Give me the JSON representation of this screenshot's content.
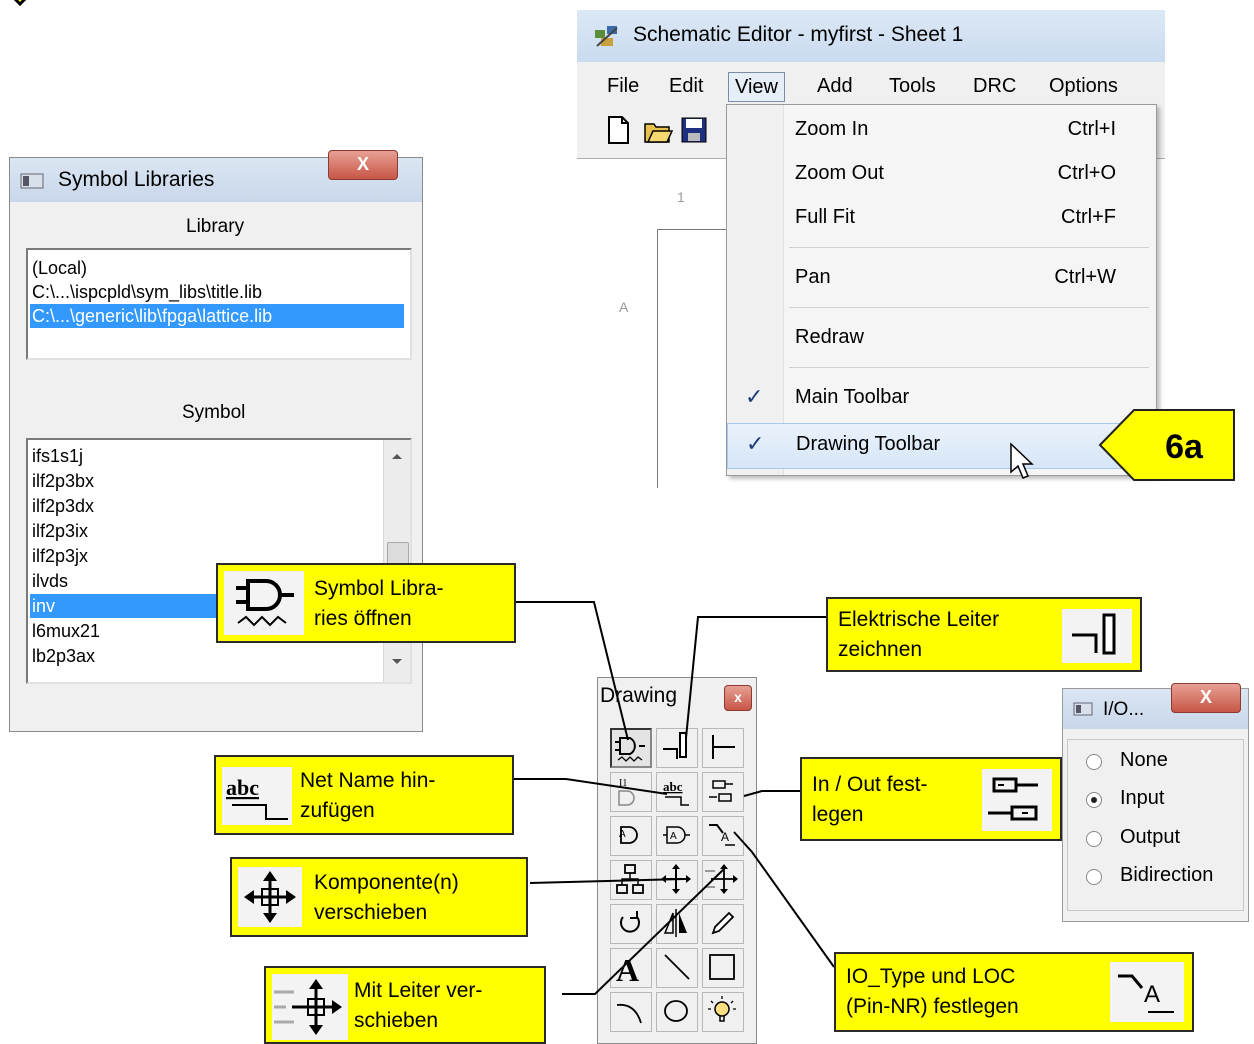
{
  "schematic_editor": {
    "title": "Schematic Editor - myfirst - Sheet 1",
    "menu": [
      "File",
      "Edit",
      "View",
      "Add",
      "Tools",
      "DRC",
      "Options"
    ],
    "active_menu": "View",
    "canvas_labels": {
      "column": "1",
      "row": "A"
    },
    "view_menu": {
      "items": [
        {
          "label": "Zoom In",
          "shortcut": "Ctrl+I",
          "checked": false
        },
        {
          "label": "Zoom Out",
          "shortcut": "Ctrl+O",
          "checked": false
        },
        {
          "label": "Full Fit",
          "shortcut": "Ctrl+F",
          "checked": false
        },
        {
          "label": "Pan",
          "shortcut": "Ctrl+W",
          "checked": false
        },
        {
          "label": "Redraw",
          "shortcut": "",
          "checked": false
        },
        {
          "label": "Main Toolbar",
          "shortcut": "",
          "checked": true
        },
        {
          "label": "Drawing Toolbar",
          "shortcut": "",
          "checked": true
        }
      ],
      "check_glyph": "✓",
      "highlighted": "Drawing Toolbar"
    }
  },
  "step_badge": "6a",
  "symbol_libraries": {
    "title": "Symbol Libraries",
    "close_label": "X",
    "library_header": "Library",
    "libraries": [
      "(Local)",
      "C:\\...\\ispcpld\\sym_libs\\title.lib",
      "C:\\...\\generic\\lib\\fpga\\lattice.lib"
    ],
    "selected_library": "C:\\...\\generic\\lib\\fpga\\lattice.lib",
    "symbol_header": "Symbol",
    "symbols": [
      "ifs1s1j",
      "ilf2p3bx",
      "ilf2p3dx",
      "ilf2p3ix",
      "ilf2p3jx",
      "ilvds",
      "inv",
      "l6mux21",
      "lb2p3ax"
    ],
    "selected_symbol": "inv"
  },
  "drawing_toolbar": {
    "title": "Drawing",
    "close_label": "x",
    "tools": [
      "symbol-libraries-icon",
      "draw-wire-icon",
      "bus-tap-icon",
      "instance-name-icon",
      "net-name-icon",
      "io-marker-icon",
      "symbol-attribute-icon",
      "pin-attribute-icon",
      "io-type-icon",
      "hierarchy-icon",
      "move-icon",
      "drag-icon",
      "rotate-icon",
      "mirror-icon",
      "pencil-icon",
      "text-icon",
      "line-icon",
      "rectangle-icon",
      "arc-icon",
      "circle-icon",
      "zoom-icon"
    ],
    "text_glyphs": {
      "text": "A",
      "net_name": "abc",
      "instance": "I1"
    }
  },
  "io_window": {
    "title": "I/O...",
    "close_label": "X",
    "options": [
      "None",
      "Input",
      "Output",
      "Bidirection"
    ],
    "selected": "Input"
  },
  "callouts": {
    "symbol_libraries": "Symbol Libra-\nries öffnen",
    "elektrische_leiter": "Elektrische Leiter\nzeichnen",
    "net_name": "Net Name hin-\nzufügen",
    "in_out": "In / Out fest-\nlegen",
    "komponente": "Komponente(n)\nverschieben",
    "io_type": "IO_Type und LOC\n(Pin-NR) festlegen",
    "mit_leiter": "Mit Leiter ver-\nschieben"
  },
  "colors": {
    "callout": "#ffff00",
    "selection": "#3399ff",
    "menu_highlight": "#d6e6f7"
  }
}
